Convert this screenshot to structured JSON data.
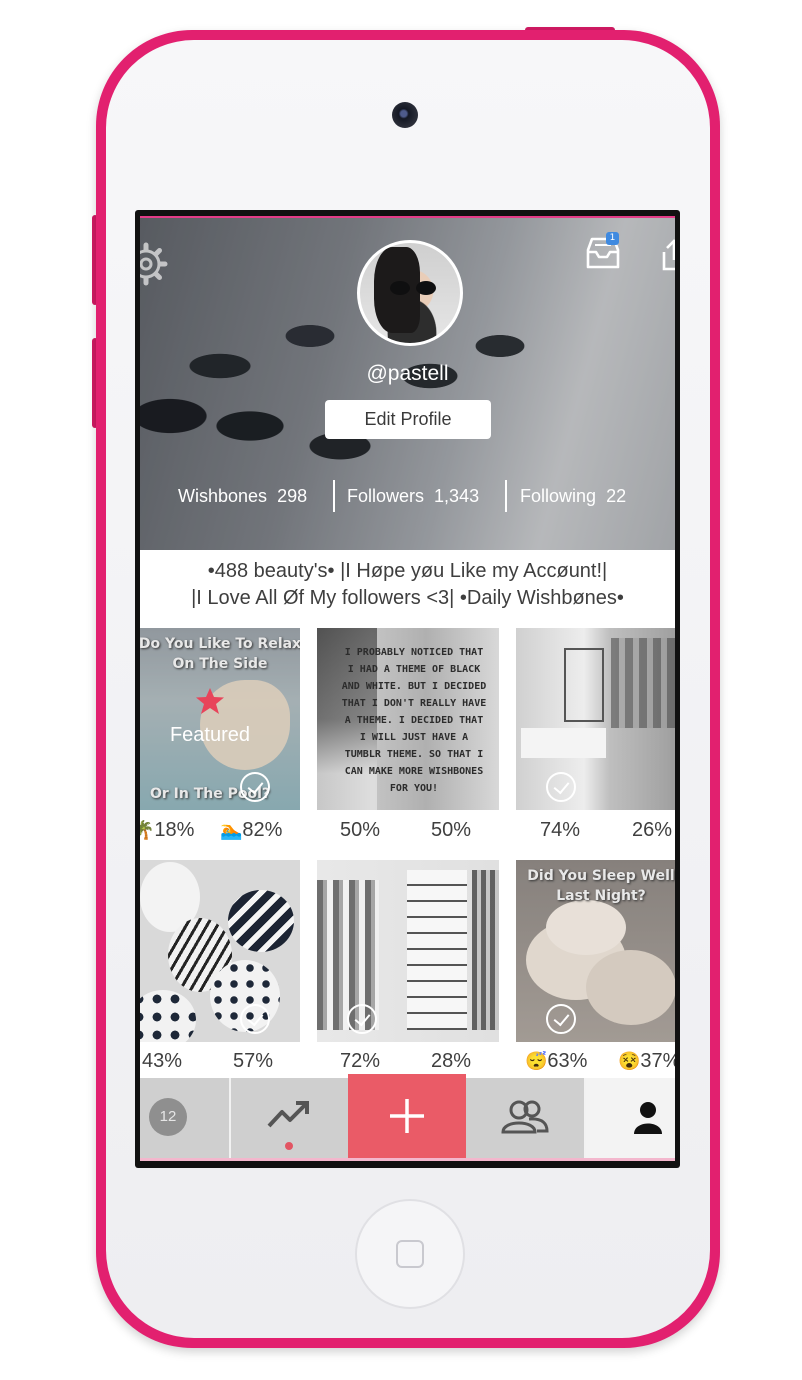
{
  "profile": {
    "username": "@pastell",
    "edit_profile_label": "Edit Profile",
    "inbox_badge": "1",
    "stats": {
      "wishbones_label": "Wishbones",
      "wishbones_count": "298",
      "followers_label": "Followers",
      "followers_count": "1,343",
      "following_label": "Following",
      "following_count": "22"
    },
    "bio_line1": "•488 beauty's• |I Høpe yøu Like my Accøunt!|",
    "bio_line2": "|I Love All Øf My followers <3| •Daily Wishbønes•"
  },
  "posts": [
    {
      "caption_top": "Do You Like To Relax On The Side",
      "caption_bottom": "Or In The Pool?",
      "featured_label": "Featured",
      "left_emoji": "🌴",
      "left_pct": "18%",
      "right_emoji": "🏊",
      "right_pct": "82%"
    },
    {
      "caption": "I PROBABLY NOTICED THAT I HAD A THEME OF BLACK AND WHITE. BUT I DECIDED THAT I DON'T REALLY HAVE A THEME. I DECIDED THAT I WILL JUST HAVE A TUMBLR THEME. SO THAT I CAN MAKE MORE WISHBONES FOR YOU!",
      "left_pct": "50%",
      "right_pct": "50%"
    },
    {
      "left_pct": "74%",
      "right_pct": "26%"
    },
    {
      "left_pct": "43%",
      "right_pct": "57%"
    },
    {
      "left_pct": "72%",
      "right_pct": "28%"
    },
    {
      "caption_top": "Did You Sleep Well Last Night?",
      "left_emoji": "😴",
      "left_pct": "63%",
      "right_emoji": "😵",
      "right_pct": "37%"
    }
  ],
  "tabbar": {
    "notifications_count": "12",
    "colors": {
      "add": "#ea5b67",
      "bar": "#cfcfcf",
      "dot": "#e25563"
    }
  }
}
